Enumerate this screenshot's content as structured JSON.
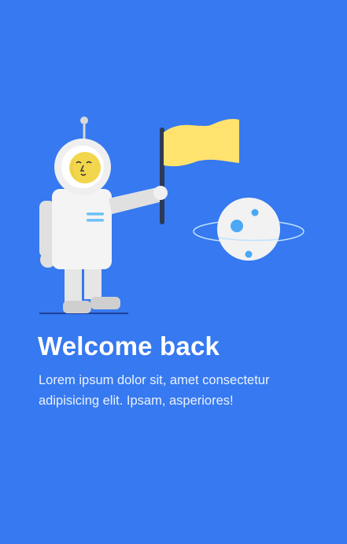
{
  "onboarding": {
    "title": "Welcome back",
    "subtitle": "Lorem ipsum dolor sit, amet consectetur adipisicing elit. Ipsam, asperiores!"
  },
  "illustration": {
    "icons": [
      "astronaut-icon",
      "flag-icon",
      "planet-icon"
    ]
  },
  "colors": {
    "background": "#3679F0",
    "flag": "#FFE36E",
    "suit": "#E8E8E8",
    "planet": "#F2F2F2",
    "crater": "#4AA8F5"
  }
}
